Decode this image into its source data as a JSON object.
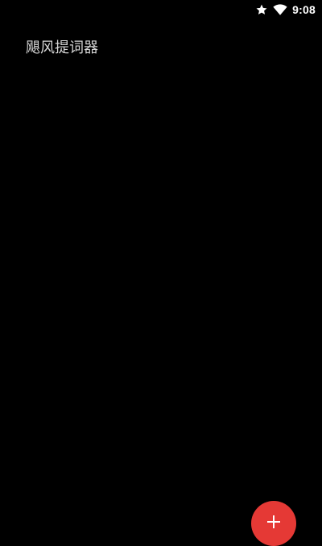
{
  "status_bar": {
    "time": "9:08",
    "icons": [
      "star-icon",
      "wifi-icon"
    ]
  },
  "app": {
    "title": "飓风提词器"
  },
  "fab": {
    "icon": "plus-icon",
    "color": "#e53935"
  },
  "theme": {
    "background": "#000000",
    "title_color": "#d6d6d6"
  }
}
